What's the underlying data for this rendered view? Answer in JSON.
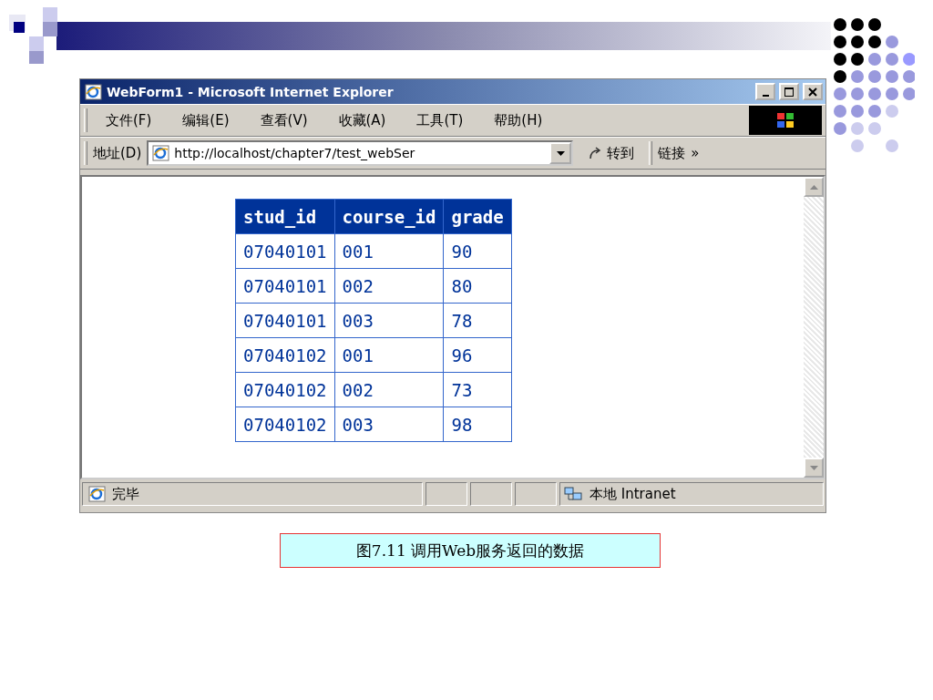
{
  "window": {
    "title": "WebForm1 - Microsoft Internet Explorer"
  },
  "menu": [
    "文件(F)",
    "编辑(E)",
    "查看(V)",
    "收藏(A)",
    "工具(T)",
    "帮助(H)"
  ],
  "address_bar": {
    "label": "地址(D)",
    "value": "http://localhost/chapter7/test_webSer",
    "go": "转到",
    "links": "链接",
    "more": "»"
  },
  "table": {
    "columns": [
      "stud_id",
      "course_id",
      "grade"
    ],
    "rows": [
      [
        "07040101",
        "001",
        "90"
      ],
      [
        "07040101",
        "002",
        "80"
      ],
      [
        "07040101",
        "003",
        "78"
      ],
      [
        "07040102",
        "001",
        "96"
      ],
      [
        "07040102",
        "002",
        "73"
      ],
      [
        "07040102",
        "003",
        "98"
      ]
    ]
  },
  "status_bar": {
    "text": "完毕",
    "zone": "本地 Intranet"
  },
  "caption": "图7.11 调用Web服务返回的数据"
}
